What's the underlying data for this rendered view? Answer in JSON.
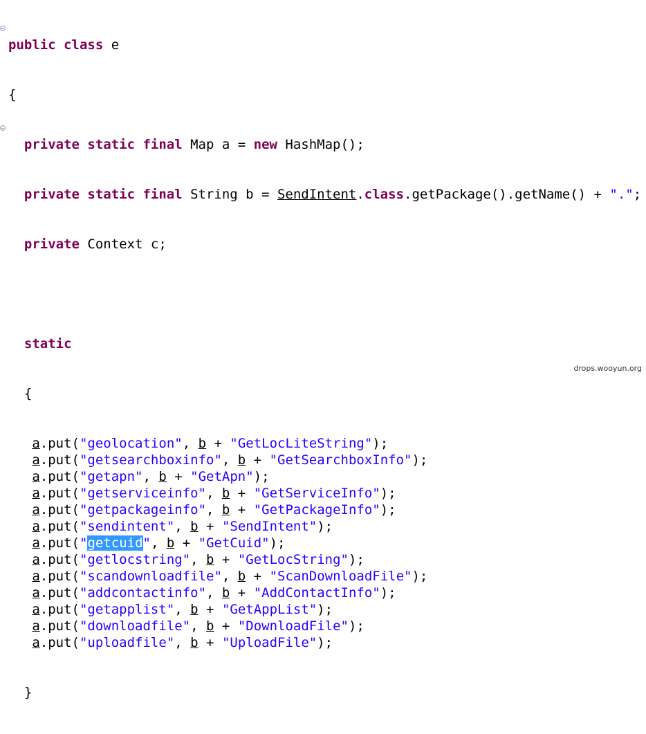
{
  "code": {
    "class_decl": {
      "kw": "public class",
      "name": " e"
    },
    "open_brace": "{",
    "field_a": {
      "kw": "private static final",
      "rest1": " Map a = ",
      "kw_new": "new",
      "rest2": " HashMap();"
    },
    "field_b": {
      "kw": "private static final",
      "rest1": " String b = ",
      "ref": "SendIntent",
      "dot": ".",
      "kw_class": "class",
      "rest2": ".getPackage().getName() + ",
      "str": "\".\"",
      "end": ";"
    },
    "field_c": {
      "kw": "private",
      "rest": " Context c;"
    },
    "static_kw": "static",
    "static_open": "{",
    "puts": [
      {
        "key": "\"geolocation\"",
        "val": "\"GetLocLiteString\""
      },
      {
        "key": "\"getsearchboxinfo\"",
        "val": "\"GetSearchboxInfo\""
      },
      {
        "key": "\"getapn\"",
        "val": "\"GetApn\""
      },
      {
        "key": "\"getserviceinfo\"",
        "val": "\"GetServiceInfo\""
      },
      {
        "key": "\"getpackageinfo\"",
        "val": "\"GetPackageInfo\""
      },
      {
        "key": "\"sendintent\"",
        "val": "\"SendIntent\""
      },
      {
        "key_pre": "\"",
        "key_sel": "getcuid",
        "key_post": "\"",
        "val": "\"GetCuid\""
      },
      {
        "key": "\"getlocstring\"",
        "val": "\"GetLocString\""
      },
      {
        "key": "\"scandownloadfile\"",
        "val": "\"ScanDownloadFile\""
      },
      {
        "key": "\"addcontactinfo\"",
        "val": "\"AddContactInfo\""
      },
      {
        "key": "\"getapplist\"",
        "val": "\"GetAppList\""
      },
      {
        "key": "\"downloadfile\"",
        "val": "\"DownloadFile\""
      },
      {
        "key": "\"uploadfile\"",
        "val": "\"UploadFile\""
      }
    ],
    "static_close": "}",
    "put_parts": {
      "a": "a",
      "call": ".put(",
      "sep": ", ",
      "b": "b",
      "plus": " + ",
      "end": ");"
    }
  },
  "watermark": "drops.wooyun.org",
  "colors": {
    "keyword": "#7f0055",
    "string": "#2a00ff",
    "selection": "#3399ff"
  }
}
